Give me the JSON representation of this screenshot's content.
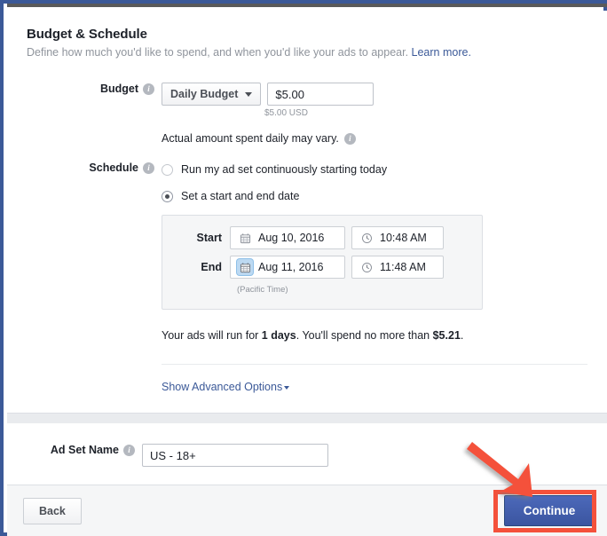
{
  "section": {
    "title": "Budget & Schedule",
    "subtitle": "Define how much you'd like to spend, and when you'd like your ads to appear.",
    "learn_more": "Learn more."
  },
  "budget": {
    "label": "Budget",
    "type_value": "Daily Budget",
    "amount_value": "$5.00",
    "currency_note": "$5.00 USD",
    "vary_note": "Actual amount spent daily may vary."
  },
  "schedule": {
    "label": "Schedule",
    "options": [
      {
        "label": "Run my ad set continuously starting today",
        "selected": false
      },
      {
        "label": "Set a start and end date",
        "selected": true
      }
    ],
    "start_label": "Start",
    "start_date": "Aug 10, 2016",
    "start_time": "10:48 AM",
    "end_label": "End",
    "end_date": "Aug 11, 2016",
    "end_time": "11:48 AM",
    "timezone_note": "(Pacific Time)",
    "summary_prefix": "Your ads will run for ",
    "summary_days": "1 days",
    "summary_middle": ". You'll spend no more than ",
    "summary_amount": "$5.21",
    "summary_suffix": "."
  },
  "advanced": {
    "label": "Show Advanced Options"
  },
  "adset": {
    "label": "Ad Set Name",
    "value": "US - 18+"
  },
  "footer": {
    "back_label": "Back",
    "continue_label": "Continue"
  },
  "colors": {
    "brand_blue": "#3b5998",
    "primary_button": "#4c69ba",
    "annotation_red": "#f4513b",
    "focus_highlight": "#bcd9f2",
    "muted_text": "#8f949c"
  }
}
